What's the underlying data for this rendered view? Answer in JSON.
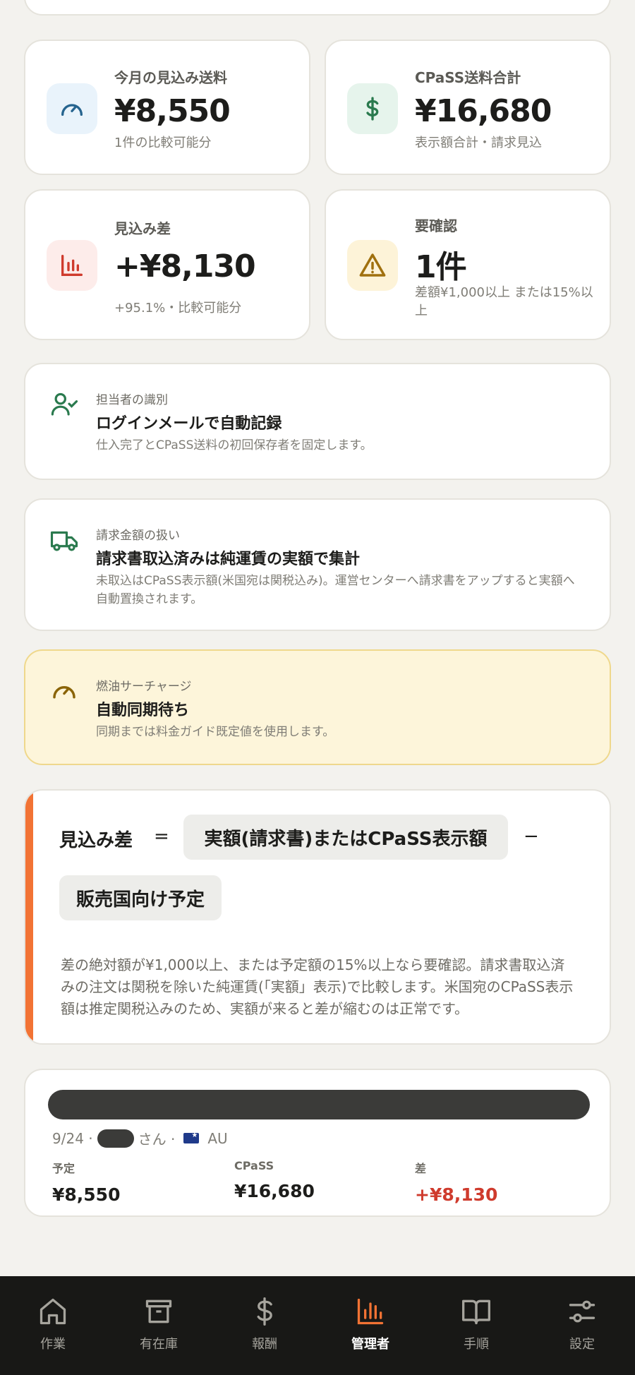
{
  "colors": {
    "accent": "#f27334",
    "warning_bg": "#fdf5da",
    "negative": "#cf3b2d",
    "nav_bg": "#181816"
  },
  "stats": [
    {
      "icon": "gauge-icon",
      "label": "今月の見込み送料",
      "value": "¥8,550",
      "sub": "1件の比較可能分"
    },
    {
      "icon": "dollar-icon",
      "label": "CPaSS送料合計",
      "value": "¥16,680",
      "sub": "表示額合計・請求見込"
    },
    {
      "icon": "bar-chart-icon",
      "label": "見込み差",
      "value": "+¥8,130",
      "sub": "+95.1%・比較可能分"
    },
    {
      "icon": "warning-icon",
      "label": "要確認",
      "value": "1件",
      "sub": "差額¥1,000以上 または15%以上"
    }
  ],
  "info_cards": [
    {
      "icon": "user-check-icon",
      "label": "担当者の識別",
      "title": "ログインメールで自動記録",
      "desc": "仕入完了とCPaSS送料の初回保存者を固定します。"
    },
    {
      "icon": "truck-icon",
      "label": "請求金額の扱い",
      "title": "請求書取込済みは純運賃の実額で集計",
      "desc": "未取込はCPaSS表示額(米国宛は関税込み)。運営センターへ請求書をアップすると実額へ自動置換されます。"
    },
    {
      "icon": "gauge-icon",
      "label": "燃油サーチャージ",
      "title": "自動同期待ち",
      "desc": "同期までは料金ガイド既定値を使用します。"
    }
  ],
  "formula": {
    "lhs": "見込み差",
    "equals": "=",
    "term1": "実額(請求書)またはCPaSS表示額",
    "minus": "−",
    "term2": "販売国向け予定",
    "note": "差の絶対額が¥1,000以上、または予定額の15%以上なら要確認。請求書取込済みの注文は関税を除いた純運賃(「実額」表示)で比較します。米国宛のCPaSS表示額は推定関税込みのため、実額が来ると差が縮むのは正常です。"
  },
  "order": {
    "date": "9/24 ·",
    "customer_suffix": "さん ·",
    "country": "AU",
    "planned_label": "予定",
    "planned_value": "¥8,550",
    "cpass_label": "CPaSS",
    "cpass_value": "¥16,680",
    "diff_label": "差",
    "diff_value": "+¥8,130"
  },
  "nav": [
    {
      "icon": "home-icon",
      "label": "作業"
    },
    {
      "icon": "archive-icon",
      "label": "有在庫"
    },
    {
      "icon": "dollar-icon",
      "label": "報酬"
    },
    {
      "icon": "bar-chart-icon",
      "label": "管理者",
      "active": true
    },
    {
      "icon": "book-icon",
      "label": "手順"
    },
    {
      "icon": "sliders-icon",
      "label": "設定"
    }
  ]
}
